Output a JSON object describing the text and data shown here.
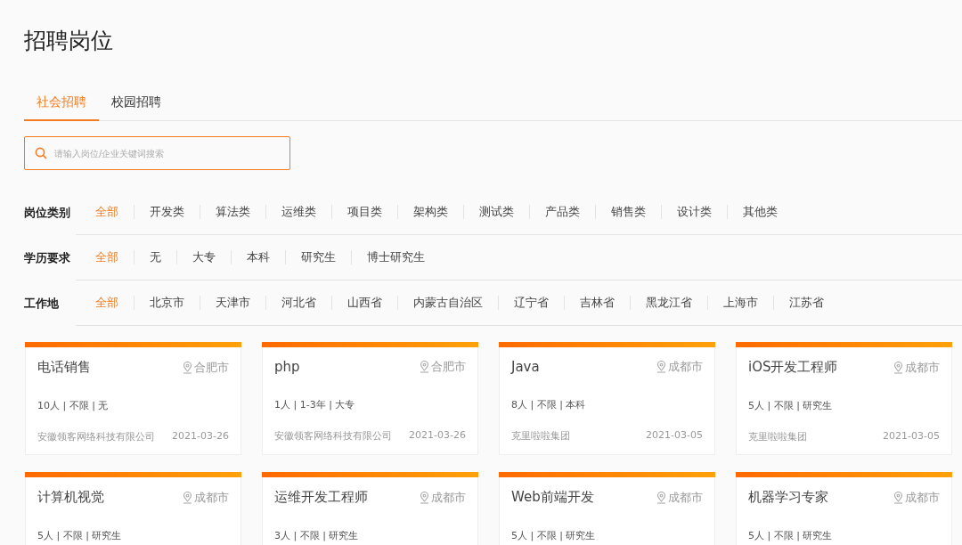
{
  "page_title": "招聘岗位",
  "tabs": [
    {
      "label": "社会招聘",
      "selected": true
    },
    {
      "label": "校园招聘",
      "selected": false
    }
  ],
  "search": {
    "placeholder": "请输入岗位/企业关键词搜索"
  },
  "filters": [
    {
      "label": "岗位类别",
      "options": [
        {
          "label": "全部",
          "selected": true
        },
        {
          "label": "开发类",
          "selected": false
        },
        {
          "label": "算法类",
          "selected": false
        },
        {
          "label": "运维类",
          "selected": false
        },
        {
          "label": "项目类",
          "selected": false
        },
        {
          "label": "架构类",
          "selected": false
        },
        {
          "label": "测试类",
          "selected": false
        },
        {
          "label": "产品类",
          "selected": false
        },
        {
          "label": "销售类",
          "selected": false
        },
        {
          "label": "设计类",
          "selected": false
        },
        {
          "label": "其他类",
          "selected": false
        }
      ]
    },
    {
      "label": "学历要求",
      "options": [
        {
          "label": "全部",
          "selected": true
        },
        {
          "label": "无",
          "selected": false
        },
        {
          "label": "大专",
          "selected": false
        },
        {
          "label": "本科",
          "selected": false
        },
        {
          "label": "研究生",
          "selected": false
        },
        {
          "label": "博士研究生",
          "selected": false
        }
      ]
    },
    {
      "label": "工作地",
      "options": [
        {
          "label": "全部",
          "selected": true
        },
        {
          "label": "北京市",
          "selected": false
        },
        {
          "label": "天津市",
          "selected": false
        },
        {
          "label": "河北省",
          "selected": false
        },
        {
          "label": "山西省",
          "selected": false
        },
        {
          "label": "内蒙古自治区",
          "selected": false
        },
        {
          "label": "辽宁省",
          "selected": false
        },
        {
          "label": "吉林省",
          "selected": false
        },
        {
          "label": "黑龙江省",
          "selected": false
        },
        {
          "label": "上海市",
          "selected": false
        },
        {
          "label": "江苏省",
          "selected": false
        }
      ]
    }
  ],
  "jobs": [
    {
      "title": "电话销售",
      "location": "合肥市",
      "meta": "10人 | 不限 | 无",
      "company": "安徽领客网络科技有限公司",
      "date": "2021-03-26"
    },
    {
      "title": "php",
      "location": "合肥市",
      "meta": "1人 | 1-3年 | 大专",
      "company": "安徽领客网络科技有限公司",
      "date": "2021-03-26"
    },
    {
      "title": "Java",
      "location": "成都市",
      "meta": "8人 | 不限 | 本科",
      "company": "克里啦啦集团",
      "date": "2021-03-05"
    },
    {
      "title": "iOS开发工程师",
      "location": "成都市",
      "meta": "5人 | 不限 | 研究生",
      "company": "克里啦啦集团",
      "date": "2021-03-05"
    },
    {
      "title": "计算机视觉",
      "location": "成都市",
      "meta": "5人 | 不限 | 研究生"
    },
    {
      "title": "运维开发工程师",
      "location": "成都市",
      "meta": "3人 | 不限 | 研究生"
    },
    {
      "title": "Web前端开发",
      "location": "成都市",
      "meta": "5人 | 不限 | 研究生"
    },
    {
      "title": "机器学习专家",
      "location": "成都市",
      "meta": "5人 | 不限 | 研究生"
    }
  ]
}
